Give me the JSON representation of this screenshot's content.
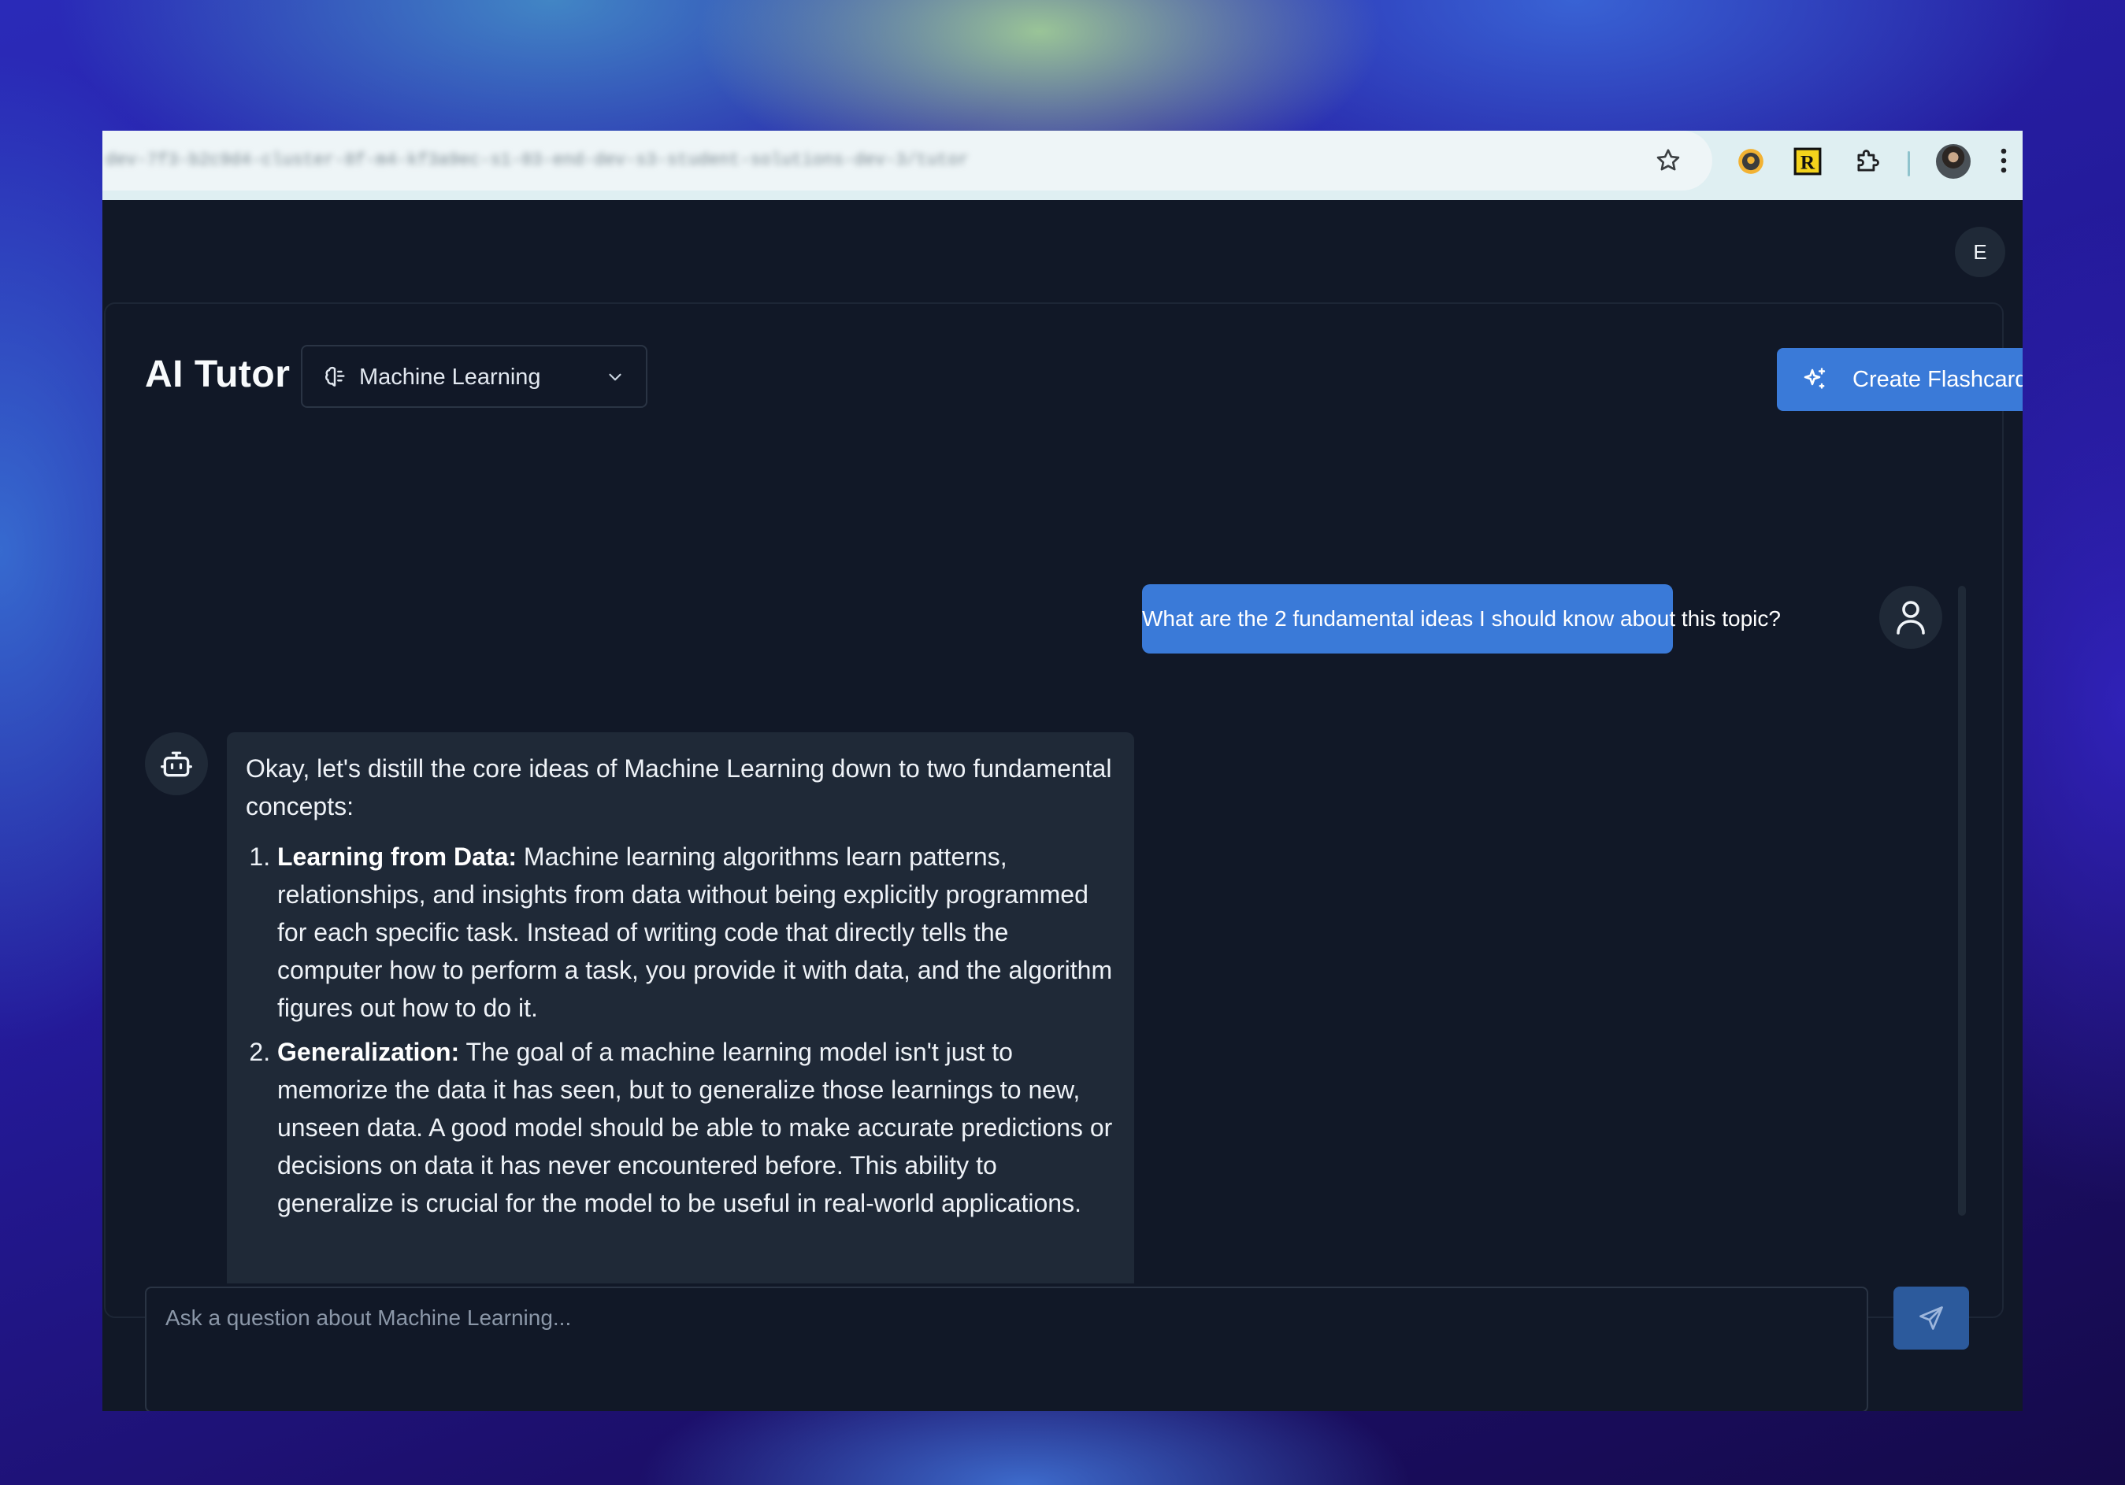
{
  "browser": {
    "url": "dev-7f3-b2c9d4-cluster-8f-m4-kf3a9ec-s1-03-end-dev-s3-student-solutions-dev-3/tutor",
    "icons": [
      "star-icon",
      "github-extension-icon",
      "r-extension-icon",
      "extensions-puzzle-icon",
      "profile-avatar",
      "kebab-menu-icon"
    ],
    "extension_r_letter": "R"
  },
  "header": {
    "user_initial": "E"
  },
  "app": {
    "title": "AI Tutor",
    "topic": "Machine Learning",
    "create_flashcards_label": "Create Flashcards",
    "accent_color": "#3a7ad8",
    "background_color": "#111827",
    "bubble_color": "#1f2937"
  },
  "chat": {
    "user_message": "What are the 2 fundamental ideas I should know about this topic?",
    "bot_intro": "Okay, let's distill the core ideas of Machine Learning down to two fundamental concepts:",
    "points": [
      {
        "title": "Learning from Data:",
        "text": " Machine learning algorithms learn patterns, relationships, and insights from data without being explicitly programmed for each specific task. Instead of writing code that directly tells the computer how to perform a task, you provide it with data, and the algorithm figures out how to do it."
      },
      {
        "title": "Generalization:",
        "text": " The goal of a machine learning model isn't just to memorize the data it has seen, but to generalize those learnings to new, unseen data. A good model should be able to make accurate predictions or decisions on data it has never encountered before. This ability to generalize is crucial for the model to be useful in real-world applications."
      }
    ],
    "input_placeholder": "Ask a question about Machine Learning..."
  }
}
